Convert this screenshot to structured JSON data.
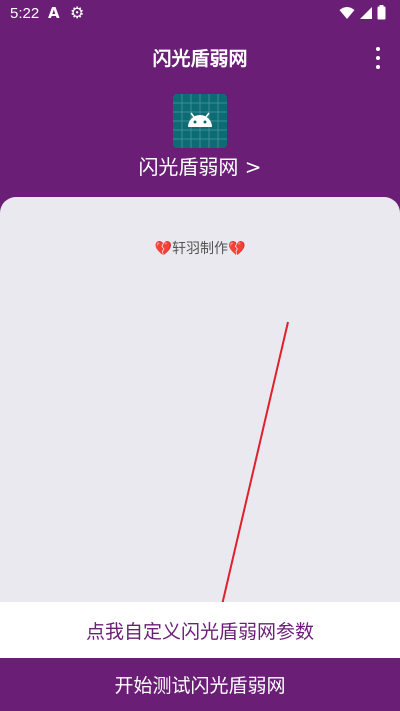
{
  "status_bar": {
    "time": "5:22",
    "icons": [
      "accessibility-a-icon",
      "gear-icon",
      "wifi-icon",
      "signal-icon",
      "battery-icon"
    ]
  },
  "header": {
    "title": "闪光盾弱网"
  },
  "app": {
    "name_link": "闪光盾弱网 >"
  },
  "card": {
    "credit_text": "轩羽制作",
    "credit_emoji_left": "💔",
    "credit_emoji_right": "💔"
  },
  "actions": {
    "customize_label": "点我自定义闪光盾弱网参数",
    "start_label": "开始测试闪光盾弱网"
  },
  "colors": {
    "primary": "#6a1e76",
    "card_bg": "#e9e9ef",
    "annotation_arrow": "#e0202a"
  }
}
